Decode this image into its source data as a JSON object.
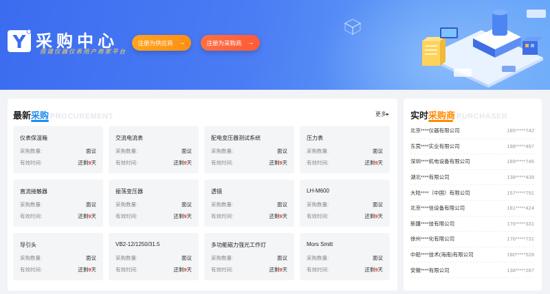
{
  "banner": {
    "brand_glyph": "Y",
    "title": "采购中心",
    "slogan": "搭建仪器仪表用户商家平台",
    "register_supplier": "注册为供应商",
    "register_buyer": "注册为采购商",
    "arrow": "→",
    "colors": {
      "bg_start": "#3b6cf0",
      "bg_end": "#6aa9fa",
      "supplier_btn": "#ff9a1a",
      "buyer_btn": "#ff6040"
    }
  },
  "latest": {
    "title_a": "最新",
    "title_b": "采购",
    "title_en": "PROCUREMENT",
    "more": "更多▸",
    "qty_label": "采购数量:",
    "valid_label": "有效时间:",
    "items": [
      {
        "name": "仪表保温箱",
        "qty": "面议",
        "remain_pre": "还剩",
        "remain_num": "9",
        "remain_unit": "天"
      },
      {
        "name": "交流电流表",
        "qty": "面议",
        "remain_pre": "还剩",
        "remain_num": "9",
        "remain_unit": "天"
      },
      {
        "name": "配电变压器测试系统",
        "qty": "面议",
        "remain_pre": "还剩",
        "remain_num": "9",
        "remain_unit": "天"
      },
      {
        "name": "压力表",
        "qty": "面议",
        "remain_pre": "还剩",
        "remain_num": "9",
        "remain_unit": "天"
      },
      {
        "name": "直流接触器",
        "qty": "面议",
        "remain_pre": "还剩",
        "remain_num": "9",
        "remain_unit": "天"
      },
      {
        "name": "振荡变压器",
        "qty": "面议",
        "remain_pre": "还剩",
        "remain_num": "9",
        "remain_unit": "天"
      },
      {
        "name": "透镜",
        "qty": "面议",
        "remain_pre": "还剩",
        "remain_num": "9",
        "remain_unit": "天"
      },
      {
        "name": "LH-M600",
        "qty": "面议",
        "remain_pre": "还剩",
        "remain_num": "9",
        "remain_unit": "天"
      },
      {
        "name": "导引头",
        "qty": "面议",
        "remain_pre": "还剩",
        "remain_num": "9",
        "remain_unit": "天"
      },
      {
        "name": "VB2-12/1250/31.5",
        "qty": "面议",
        "remain_pre": "还剩",
        "remain_num": "9",
        "remain_unit": "天"
      },
      {
        "name": "多功能磁力强光工作灯",
        "qty": "面议",
        "remain_pre": "还剩",
        "remain_num": "9",
        "remain_unit": "天"
      },
      {
        "name": "Mors Smitt",
        "qty": "面议",
        "remain_pre": "还剩",
        "remain_num": "9",
        "remain_unit": "天"
      }
    ]
  },
  "purchasers": {
    "title_a": "实时",
    "title_b": "采购商",
    "title_en": "PURCHASER",
    "items": [
      {
        "company": "北京****仪器有限公司",
        "phone": "185*****742"
      },
      {
        "company": "东莞****实业有限公司",
        "phone": "198*****497"
      },
      {
        "company": "深圳****机电设备有限公司",
        "phone": "189*****746"
      },
      {
        "company": "湖北****有限公司",
        "phone": "138*****439"
      },
      {
        "company": "大陆****（中国）有限公司",
        "phone": "157*****791"
      },
      {
        "company": "北京****信设备有限公司",
        "phone": "181*****424"
      },
      {
        "company": "新疆****技有限公司",
        "phone": "176*****331"
      },
      {
        "company": "徐州****化有限公司",
        "phone": "176*****731"
      },
      {
        "company": "中船****技术(海南)有限公司",
        "phone": "180*****528"
      },
      {
        "company": "安徽****有限公司",
        "phone": "138*****287"
      }
    ]
  }
}
